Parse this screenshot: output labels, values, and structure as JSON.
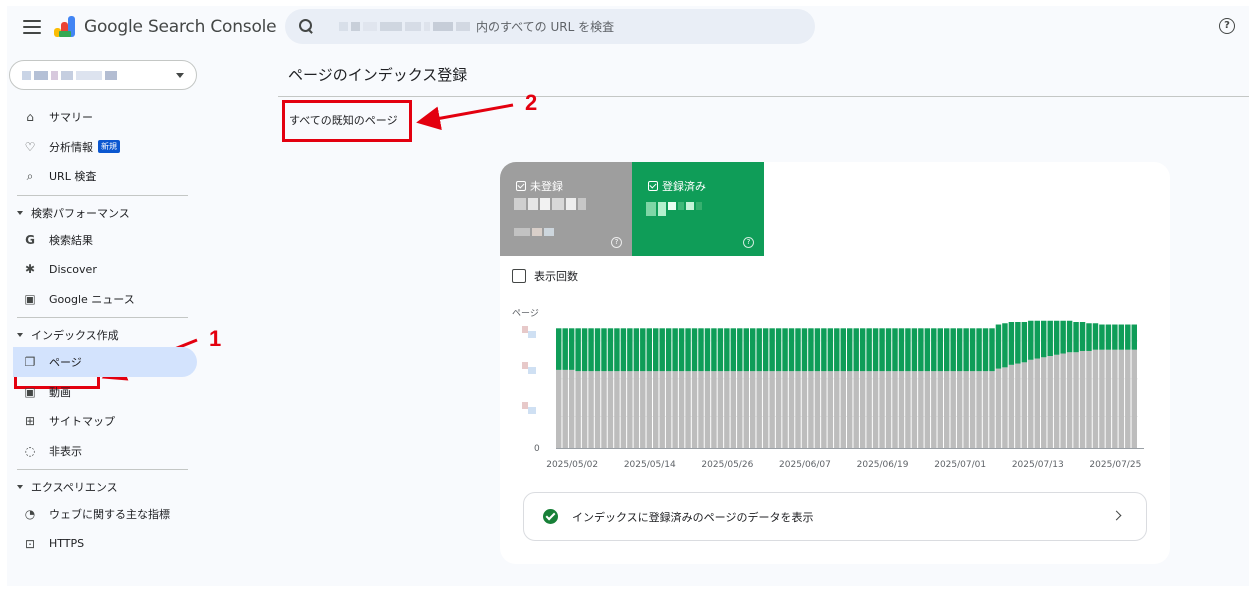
{
  "header": {
    "app_name": "Google Search Console",
    "search_suffix": "内のすべての URL を検査"
  },
  "sidebar": {
    "items_top": [
      {
        "label": "サマリー",
        "icon": "home-icon"
      },
      {
        "label": "分析情報",
        "icon": "lightbulb-icon",
        "badge": "新規"
      },
      {
        "label": "URL 検査",
        "icon": "search-icon"
      }
    ],
    "sections": [
      {
        "title": "検索パフォーマンス",
        "items": [
          {
            "label": "検索結果",
            "icon": "google-g-icon"
          },
          {
            "label": "Discover",
            "icon": "asterisk-icon"
          },
          {
            "label": "Google ニュース",
            "icon": "news-icon"
          }
        ]
      },
      {
        "title": "インデックス作成",
        "items": [
          {
            "label": "ページ",
            "icon": "pages-icon",
            "active": true
          },
          {
            "label": "動画",
            "icon": "video-icon"
          },
          {
            "label": "サイトマップ",
            "icon": "sitemap-icon"
          },
          {
            "label": "非表示",
            "icon": "eye-off-icon"
          }
        ]
      },
      {
        "title": "エクスペリエンス",
        "items": [
          {
            "label": "ウェブに関する主な指標",
            "icon": "gauge-icon"
          },
          {
            "label": "HTTPS",
            "icon": "lock-icon"
          }
        ]
      }
    ]
  },
  "main": {
    "title": "ページのインデックス登録",
    "filter": "すべての既知のページ",
    "tiles": {
      "not_indexed": "未登録",
      "indexed": "登録済み"
    },
    "impressions_label": "表示回数",
    "cta_label": "インデックスに登録済みのページのデータを表示"
  },
  "annotations": {
    "marker_1": "1",
    "marker_2": "2"
  },
  "colors": {
    "indexed": "#0f9d58",
    "not_indexed": "#bdbdbd",
    "annotation": "#e3000f",
    "active_nav": "#d3e3fd"
  },
  "chart_data": {
    "type": "bar",
    "stacked": true,
    "ylabel": "ページ",
    "y_ticks_visible": [
      "0"
    ],
    "x_tick_labels": [
      "2025/05/02",
      "2025/05/14",
      "2025/05/26",
      "2025/06/07",
      "2025/06/19",
      "2025/07/01",
      "2025/07/13",
      "2025/07/25"
    ],
    "x_start": "2025/04/30",
    "bar_count": 90,
    "series": [
      {
        "name": "未登録",
        "color": "#bdbdbd"
      },
      {
        "name": "登録済み",
        "color": "#0f9d58"
      }
    ],
    "relative_values_note_free": true,
    "not_indexed_rel": [
      62,
      62,
      62,
      61,
      61,
      61,
      61,
      61,
      61,
      61,
      61,
      61,
      61,
      61,
      61,
      61,
      61,
      61,
      61,
      61,
      61,
      61,
      61,
      61,
      61,
      61,
      61,
      61,
      61,
      61,
      61,
      61,
      61,
      61,
      61,
      61,
      61,
      61,
      61,
      61,
      61,
      61,
      61,
      61,
      61,
      61,
      61,
      61,
      61,
      61,
      61,
      61,
      61,
      61,
      61,
      61,
      61,
      61,
      61,
      61,
      61,
      61,
      61,
      61,
      61,
      61,
      61,
      61,
      63,
      64,
      66,
      67,
      68,
      70,
      71,
      72,
      73,
      74,
      75,
      76,
      76,
      77,
      77,
      78,
      78,
      78,
      78,
      78,
      78,
      78
    ],
    "indexed_rel": [
      33,
      33,
      33,
      34,
      34,
      34,
      34,
      34,
      34,
      34,
      34,
      34,
      34,
      34,
      34,
      34,
      34,
      34,
      34,
      34,
      34,
      34,
      34,
      34,
      34,
      34,
      34,
      34,
      34,
      34,
      34,
      34,
      34,
      34,
      34,
      34,
      34,
      34,
      34,
      34,
      34,
      34,
      34,
      34,
      34,
      34,
      34,
      34,
      34,
      34,
      34,
      34,
      34,
      34,
      34,
      34,
      34,
      34,
      34,
      34,
      34,
      34,
      34,
      34,
      34,
      34,
      34,
      34,
      35,
      35,
      34,
      33,
      32,
      31,
      30,
      29,
      28,
      27,
      26,
      25,
      24,
      23,
      22,
      21,
      20,
      20,
      20,
      20,
      20,
      20
    ]
  }
}
